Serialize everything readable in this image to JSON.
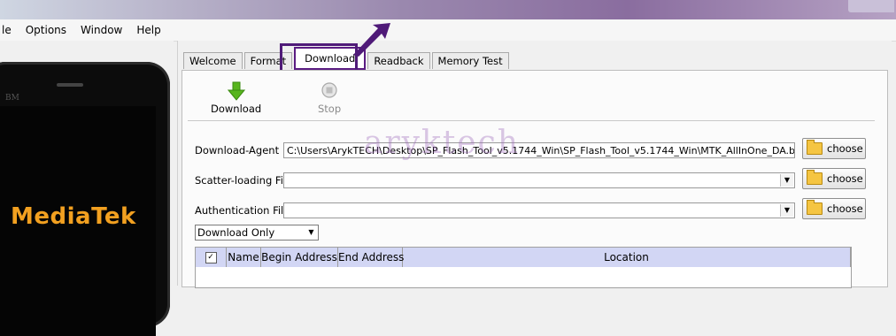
{
  "menu": {
    "items": [
      "le",
      "Options",
      "Window",
      "Help"
    ]
  },
  "phone": {
    "brand_small": "BM",
    "brand": "MediaTek"
  },
  "tabs": [
    {
      "label": "Welcome",
      "active": false
    },
    {
      "label": "Format",
      "active": false
    },
    {
      "label": "Download",
      "active": true
    },
    {
      "label": "Readback",
      "active": false
    },
    {
      "label": "Memory Test",
      "active": false
    }
  ],
  "toolbar": {
    "download_label": "Download",
    "stop_label": "Stop",
    "download_icon": "down-arrow-icon",
    "stop_icon": "stop-icon"
  },
  "fields": {
    "download_agent": {
      "label": "Download-Agent",
      "value": "C:\\Users\\ArykTECH\\Desktop\\SP_Flash_Tool_v5.1744_Win\\SP_Flash_Tool_v5.1744_Win\\MTK_AllInOne_DA.bin"
    },
    "scatter": {
      "label": "Scatter-loading File",
      "value": ""
    },
    "auth": {
      "label": "Authentication File",
      "value": ""
    },
    "choose_label": "choose"
  },
  "mode": {
    "selected": "Download Only"
  },
  "table": {
    "headers": [
      "Name",
      "Begin Address",
      "End Address",
      "Location"
    ],
    "select_all_checked": true
  },
  "watermark": "aryktech",
  "colors": {
    "highlight": "#4f1a78",
    "table_header": "#d2d6f4",
    "brand": "#f2a020"
  }
}
